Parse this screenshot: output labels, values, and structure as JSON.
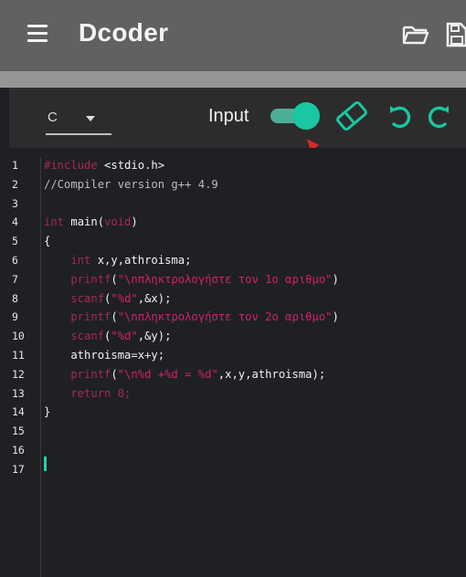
{
  "appbar": {
    "title": "Dcoder",
    "icons": [
      "menu-icon",
      "folder-open-icon",
      "save-icon"
    ]
  },
  "toolbar": {
    "language": "C",
    "input_label": "Input",
    "input_toggle_on": true,
    "icons": [
      "eraser-icon",
      "undo-icon",
      "redo-icon"
    ]
  },
  "colors": {
    "accent": "#19c7a2",
    "appbar": "#616161",
    "editor_bg": "#1f2024",
    "keyword": "#a52a4e",
    "string": "#d1206a",
    "annotation_arrow": "#d62828"
  },
  "editor": {
    "line_numbers": [
      "1",
      "2",
      "3",
      "4",
      "5",
      "6",
      "7",
      "8",
      "9",
      "10",
      "11",
      "12",
      "13",
      "14",
      "15",
      "16",
      "17"
    ],
    "lines": [
      [
        {
          "t": "#include",
          "c": "kw"
        },
        {
          "t": " <stdio.h>",
          "c": "plain"
        }
      ],
      [
        {
          "t": "//Compiler version g++ 4.9",
          "c": "cmt"
        }
      ],
      [],
      [
        {
          "t": "int",
          "c": "kw"
        },
        {
          "t": " main(",
          "c": "plain"
        },
        {
          "t": "void",
          "c": "kw"
        },
        {
          "t": ")",
          "c": "plain"
        }
      ],
      [
        {
          "t": "{",
          "c": "plain"
        }
      ],
      [
        {
          "t": "    int",
          "c": "kw"
        },
        {
          "t": " x,y,athroisma;",
          "c": "plain"
        }
      ],
      [
        {
          "t": "    printf",
          "c": "kw"
        },
        {
          "t": "(",
          "c": "plain"
        },
        {
          "t": "\"\\nπληκτρολογήστε τον 1ο αριθμο\"",
          "c": "str"
        },
        {
          "t": ")",
          "c": "plain"
        }
      ],
      [
        {
          "t": "    scanf",
          "c": "kw"
        },
        {
          "t": "(",
          "c": "plain"
        },
        {
          "t": "\"%d\"",
          "c": "str"
        },
        {
          "t": ",&x);",
          "c": "plain"
        }
      ],
      [
        {
          "t": "    printf",
          "c": "kw"
        },
        {
          "t": "(",
          "c": "plain"
        },
        {
          "t": "\"\\nπληκτρολογήστε τον 2ο αριθμο\"",
          "c": "str"
        },
        {
          "t": ")",
          "c": "plain"
        }
      ],
      [
        {
          "t": "    scanf",
          "c": "kw"
        },
        {
          "t": "(",
          "c": "plain"
        },
        {
          "t": "\"%d\"",
          "c": "str"
        },
        {
          "t": ",&y);",
          "c": "plain"
        }
      ],
      [
        {
          "t": "    athroisma=x+y;",
          "c": "plain"
        }
      ],
      [
        {
          "t": "    printf",
          "c": "kw"
        },
        {
          "t": "(",
          "c": "plain"
        },
        {
          "t": "\"\\n%d +%d = %d\"",
          "c": "str"
        },
        {
          "t": ",x,y,athroisma);",
          "c": "plain"
        }
      ],
      [
        {
          "t": "    return",
          "c": "kw"
        },
        {
          "t": " 0;",
          "c": "kw"
        }
      ],
      [
        {
          "t": "}",
          "c": "plain"
        }
      ],
      [],
      [],
      []
    ]
  }
}
